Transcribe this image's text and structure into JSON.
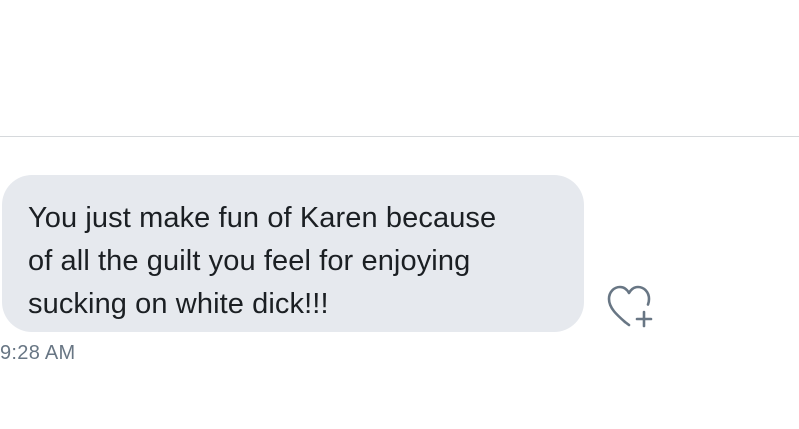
{
  "conversation": {
    "message": {
      "text": "You just make fun of Karen because\nof all the guilt you feel for enjoying\nsucking on white dick!!!",
      "timestamp": "9:28 AM",
      "bubble_color": "#e6e9ee",
      "text_color": "#1b1f23"
    },
    "actions": {
      "like_icon": "heart-plus-icon",
      "icon_color": "#687684"
    }
  }
}
